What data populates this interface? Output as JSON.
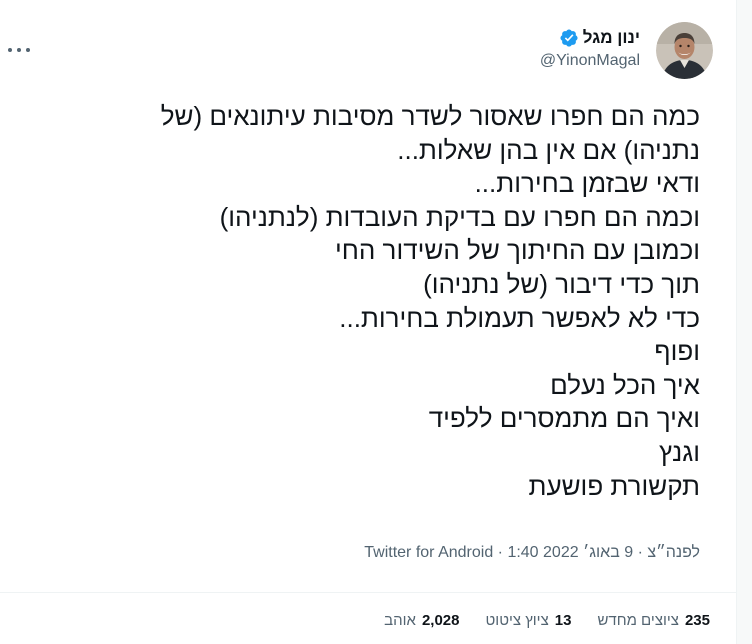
{
  "author": {
    "display_name": "ינון מגל",
    "handle": "@YinonMagal",
    "verified": true,
    "verified_color": "#1d9bf0",
    "avatar_icon": "profile-photo"
  },
  "menu": {
    "more_icon": "more-horizontal-icon"
  },
  "tweet": {
    "lines": [
      "כמה הם חפרו שאסור לשדר מסיבות עיתונאים (של",
      "נתניהו) אם אין בהן שאלות...",
      "ודאי שבזמן בחירות...",
      "וכמה הם חפרו עם בדיקת העובדות (לנתניהו)",
      "וכמובן עם החיתוך של השידור החי",
      "תוך כדי דיבור (של נתניהו)",
      "כדי לא לאפשר תעמולת בחירות...",
      "ופוף",
      "איך הכל נעלם",
      "ואיך הם מתמסרים ללפיד",
      "וגנץ",
      "תקשורת פושעת"
    ]
  },
  "meta": {
    "timestamp": "1:40 לפנה״צ · 9 באוג׳ 2022",
    "separator": " · ",
    "source": "Twitter for Android"
  },
  "stats": {
    "retweets_count": "235",
    "retweets_label": "ציוצים מחדש",
    "quotes_count": "13",
    "quotes_label": "ציוץ ציטוט",
    "likes_count": "2,028",
    "likes_label": "אוהב"
  }
}
